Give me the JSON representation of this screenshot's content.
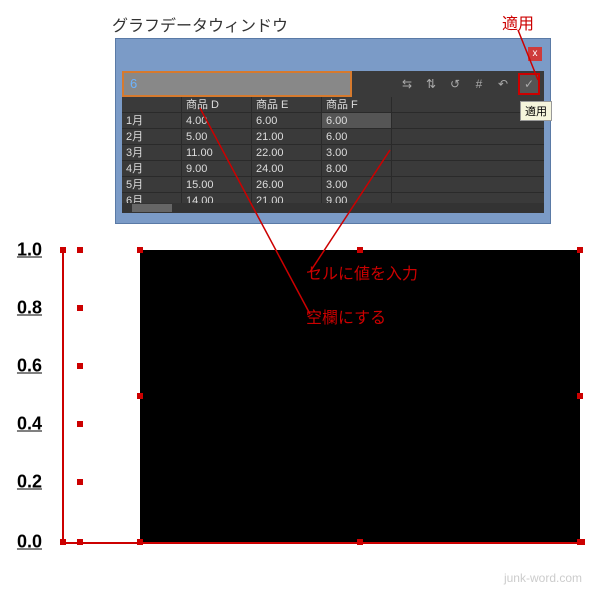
{
  "title": "グラフデータウィンドウ",
  "apply_top_label": "適用",
  "tooltip_apply": "適用",
  "input_value": "6",
  "close_glyph": "x",
  "toolbar": {
    "icon1": "⇆",
    "icon2": "⇅",
    "icon3": "↺",
    "icon4": "#",
    "icon5": "↶",
    "icon6": "✓"
  },
  "grid": {
    "headers": [
      "",
      "商品 D",
      "商品 E",
      "商品 F"
    ],
    "rows": [
      {
        "label": "1月",
        "d": "4.00",
        "e": "6.00",
        "f": "6.00"
      },
      {
        "label": "2月",
        "d": "5.00",
        "e": "21.00",
        "f": "6.00"
      },
      {
        "label": "3月",
        "d": "11.00",
        "e": "22.00",
        "f": "3.00"
      },
      {
        "label": "4月",
        "d": "9.00",
        "e": "24.00",
        "f": "8.00"
      },
      {
        "label": "5月",
        "d": "15.00",
        "e": "26.00",
        "f": "3.00"
      },
      {
        "label": "6月",
        "d": "14.00",
        "e": "21.00",
        "f": "9.00"
      }
    ]
  },
  "annotations": {
    "cell_value": "セルに値を入力",
    "blank": "空欄にする"
  },
  "watermark": "junk-word.com",
  "chart_data": {
    "type": "bar",
    "title": "",
    "xlabel": "",
    "ylabel": "",
    "ylim": [
      0.0,
      1.0
    ],
    "yticks": [
      0.0,
      0.2,
      0.4,
      0.6,
      0.8,
      1.0
    ],
    "categories": [],
    "series": []
  }
}
